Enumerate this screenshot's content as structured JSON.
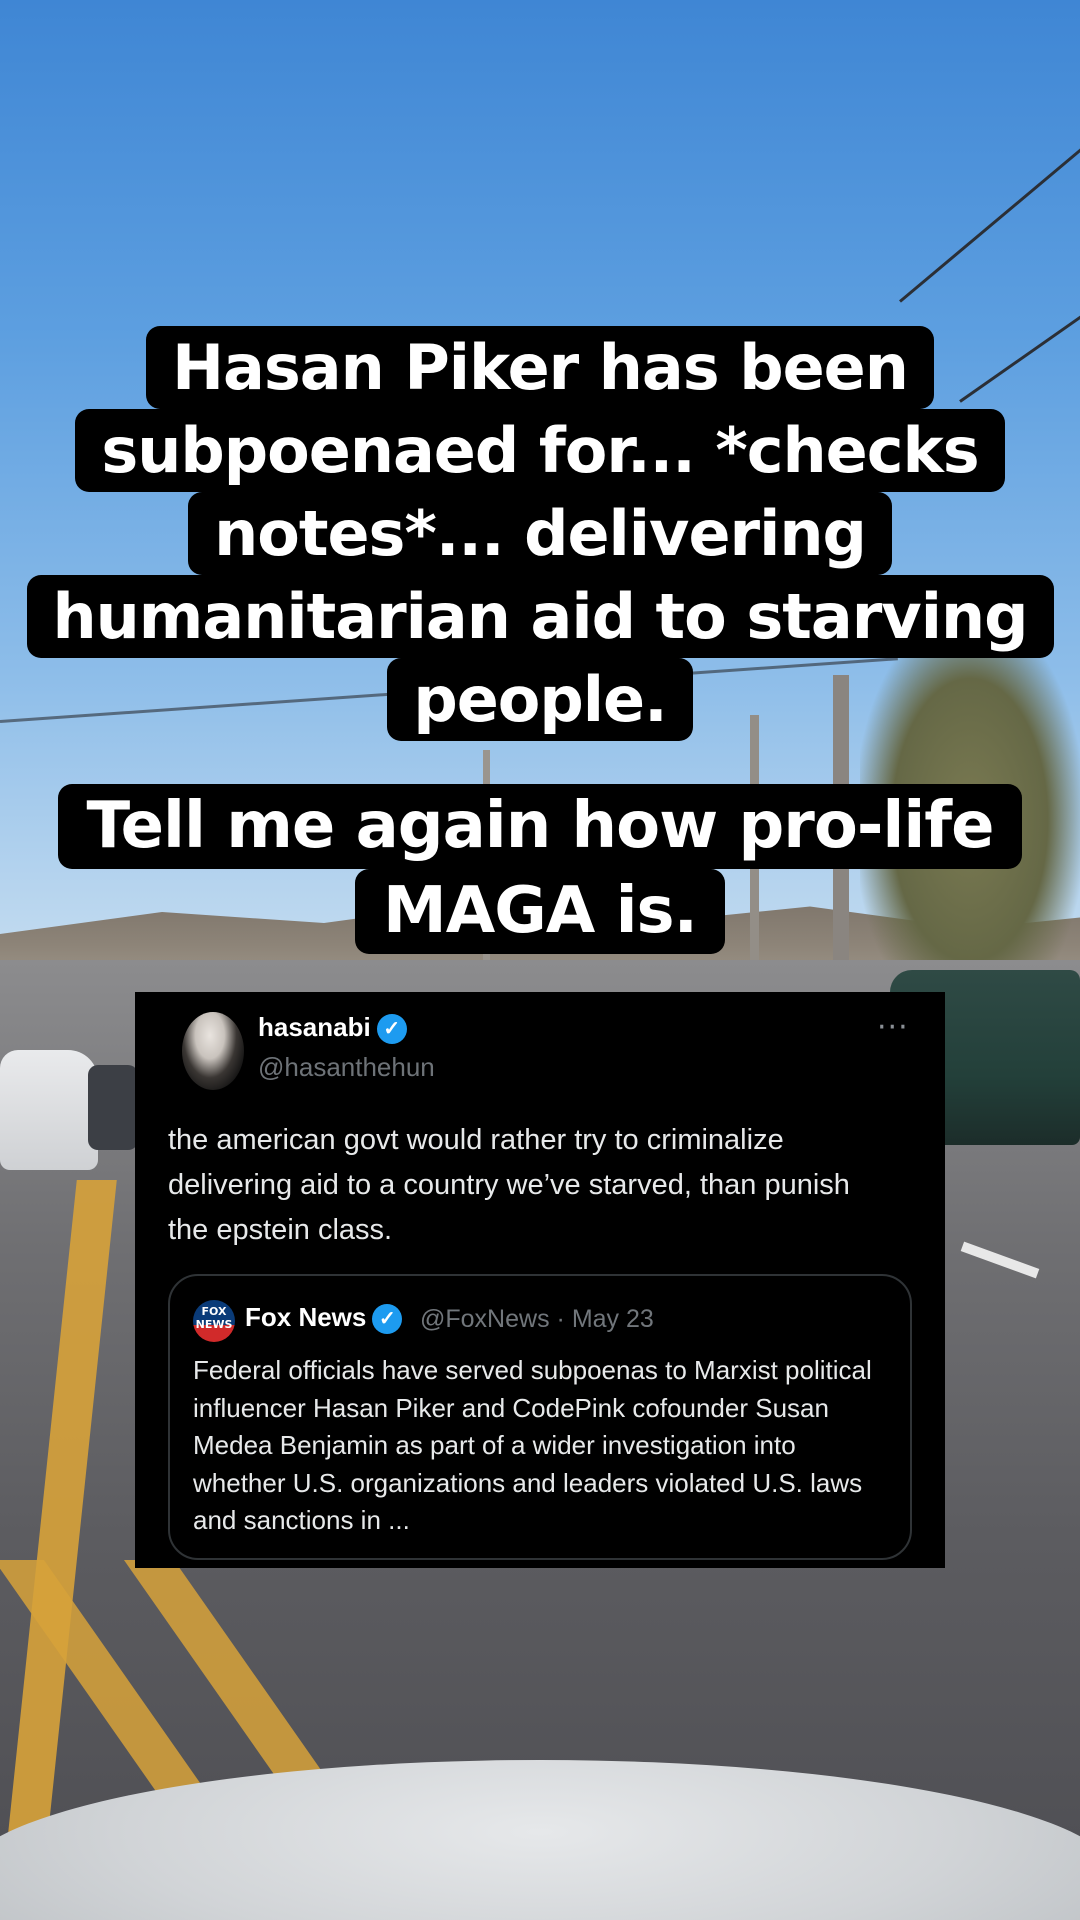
{
  "caption_top": [
    "Hasan Piker has been",
    "subpoenaed for... *checks",
    "notes*... delivering",
    "humanitarian aid to starving",
    "people."
  ],
  "caption_bottom": [
    "Tell me again how pro-life",
    "MAGA is."
  ],
  "tweet": {
    "name": "hasanabi",
    "handle": "@hasanthehun",
    "more_icon": "···",
    "text": "the american govt would rather try to criminalize delivering aid to a country we’ve starved, than punish the epstein class.",
    "quote": {
      "logo_text": "FOX NEWS",
      "name": "Fox News",
      "handle": "@FoxNews",
      "separator": "·",
      "date": "May 23",
      "text": "Federal officials have served subpoenas to Marxist political influencer Hasan Piker and CodePink cofounder Susan Medea Benjamin as part of a wider investigation into whether U.S. organizations and leaders violated U.S. laws and sanctions in ..."
    }
  },
  "colors": {
    "verified": "#1d9bf0",
    "card_bg": "#000000",
    "caption_bg": "#000000",
    "caption_text": "#ffffff"
  }
}
